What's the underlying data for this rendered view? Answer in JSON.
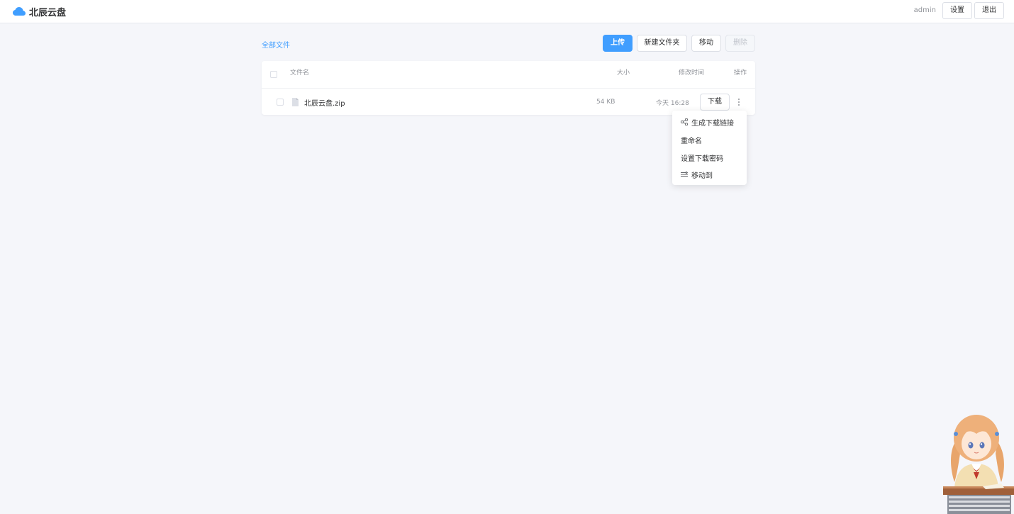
{
  "app": {
    "name": "北辰云盘",
    "brand_color": "#409eff"
  },
  "header": {
    "username": "admin",
    "settings_label": "设置",
    "logout_label": "退出"
  },
  "breadcrumb": {
    "label": "全部文件"
  },
  "toolbar": {
    "upload_label": "上传",
    "new_folder_label": "新建文件夹",
    "move_label": "移动",
    "delete_label": "删除"
  },
  "table": {
    "columns": {
      "name": "文件名",
      "size": "大小",
      "modified": "修改时间",
      "actions": "操作"
    },
    "rows": [
      {
        "name": "北辰云盘.zip",
        "size": "54 KB",
        "modified": "今天 16:28",
        "download_label": "下载",
        "icon": "file-icon"
      }
    ]
  },
  "context_menu": {
    "items": [
      {
        "label": "生成下载链接",
        "icon": "share-icon"
      },
      {
        "label": "重命名"
      },
      {
        "label": "设置下载密码"
      },
      {
        "label": "移动到",
        "icon": "move-icon"
      }
    ]
  },
  "decoration": {
    "mascot": "anime-girl-at-desk"
  }
}
